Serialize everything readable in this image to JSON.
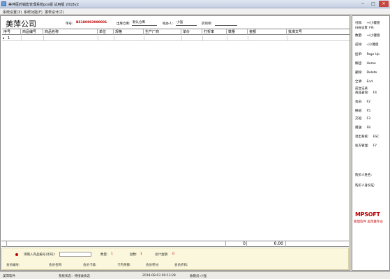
{
  "window": {
    "title": "美萍医药销售管理系统pos版 试用版 2018v2",
    "minimize": "─",
    "maximize": "□",
    "close": "✕"
  },
  "menu": [
    "系统设置(X)",
    "系统功能(F)",
    "报表设计(Z)"
  ],
  "header": {
    "company": "美萍公司",
    "order_no_label": "单号:",
    "order_no": "BS180803000001",
    "warehouse_label": "出库仓库:",
    "warehouse": "默认仓库",
    "handler_label": "经办人:",
    "handler": "小强",
    "pharmacist_label": "药剂师:",
    "pharmacist": ""
  },
  "grid": {
    "columns": [
      "序号",
      "商品编号",
      "商品名称",
      "单位",
      "规格",
      "生产厂商",
      "单价",
      "打折率",
      "数量",
      "金额",
      "批准文号"
    ],
    "row_pointer": "▸",
    "rows": [
      {
        "seq": "1"
      }
    ]
  },
  "totals": {
    "quantity": "0",
    "amount": "0.00"
  },
  "input_panel": {
    "barcode_label": "请输入商品编号(条码):",
    "barcode_value": "",
    "qty_label": "数量:",
    "qty_value": "1",
    "lines_label": "副数:",
    "lines_value": "1",
    "total_label": "总计金额:",
    "total_value": "0",
    "member_no": "会员编号:",
    "member_name": "会员名称:",
    "member_card": "会员卡级:",
    "card_balance": "卡内余额:",
    "member_points": "会员积分:",
    "member_discount": "会员折扣:"
  },
  "shortcuts": [
    {
      "label": "付款:",
      "key": "+(小键盘"
    },
    {
      "label": "(系统设置: F9)",
      "key": ""
    },
    {
      "label": "数量:",
      "key": "+(小键盘"
    },
    {
      "label": "前除:",
      "key": "-(小键盘"
    },
    {
      "label": "挂单:",
      "key": "Page Up"
    },
    {
      "label": "解挂:",
      "key": "Home"
    },
    {
      "label": "删除:",
      "key": "Delete"
    },
    {
      "label": "全清:",
      "key": "End"
    },
    {
      "label": "前台记录",
      "key": ""
    },
    {
      "label": "商品查询:",
      "key": "F4"
    },
    {
      "label": "会员:",
      "key": "F2"
    },
    {
      "label": "换班:",
      "key": "F5"
    },
    {
      "label": "交班:",
      "key": "F3"
    },
    {
      "label": "赠送:",
      "key": "F8"
    },
    {
      "label": "退出系统:",
      "key": "ESC"
    },
    {
      "label": "处方管理:",
      "key": "F7"
    }
  ],
  "buyer": {
    "name_label": "购买人姓名:",
    "id_label": "购买人身份证:"
  },
  "brand": {
    "logo_prefix": "M",
    "logo_text": "PSOFT",
    "tagline": "管理软件 美萍最专业"
  },
  "status": {
    "company": "美萍软件",
    "state": "系统状态：待接收状态",
    "datetime": "2018-08-03 09:13:28",
    "cashier": "收银员:小强"
  }
}
